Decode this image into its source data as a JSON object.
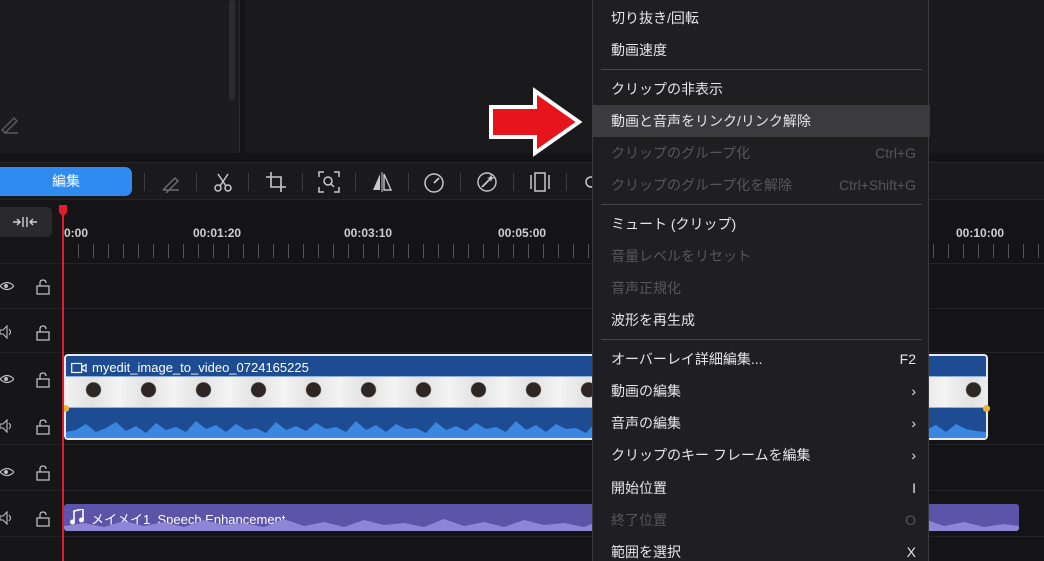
{
  "toolbar": {
    "edit_label": "編集",
    "icons": [
      "pen-icon",
      "scissors-icon",
      "crop-icon",
      "zoom-focus-icon",
      "mirror-icon",
      "speed-gauge-icon",
      "magic-wand-icon",
      "film-strip-icon",
      "settings-icon"
    ]
  },
  "ruler": {
    "ticks": [
      "0:00",
      "00:01:20",
      "00:03:10",
      "00:05:00",
      "00:10:00"
    ]
  },
  "clips": {
    "video_title": "myedit_image_to_video_0724165225",
    "audio_title": "メイメイ1_Speech Enhancement"
  },
  "colors": {
    "accent": "#2f8bf0",
    "video_clip": "#1d4c93",
    "audio_clip": "#5c54a8",
    "playhead": "#e11d2b",
    "annotation_arrow": "#e8141c"
  },
  "menu": {
    "items": [
      {
        "label": "切り抜き/回転",
        "shortcut": "",
        "state": "enabled"
      },
      {
        "label": "動画速度",
        "shortcut": "",
        "state": "enabled"
      },
      {
        "label": "クリップの非表示",
        "shortcut": "",
        "state": "enabled"
      },
      {
        "label": "動画と音声をリンク/リンク解除",
        "shortcut": "",
        "state": "highlighted"
      },
      {
        "label": "クリップのグループ化",
        "shortcut": "Ctrl+G",
        "state": "disabled"
      },
      {
        "label": "クリップのグループ化を解除",
        "shortcut": "Ctrl+Shift+G",
        "state": "disabled"
      },
      {
        "label": "ミュート (クリップ)",
        "shortcut": "",
        "state": "enabled"
      },
      {
        "label": "音量レベルをリセット",
        "shortcut": "",
        "state": "disabled"
      },
      {
        "label": "音声正規化",
        "shortcut": "",
        "state": "disabled"
      },
      {
        "label": "波形を再生成",
        "shortcut": "",
        "state": "enabled"
      },
      {
        "label": "オーバーレイ詳細編集...",
        "shortcut": "F2",
        "state": "enabled"
      },
      {
        "label": "動画の編集",
        "shortcut": "›",
        "state": "enabled"
      },
      {
        "label": "音声の編集",
        "shortcut": "›",
        "state": "enabled"
      },
      {
        "label": "クリップのキー フレームを編集",
        "shortcut": "›",
        "state": "enabled"
      },
      {
        "label": "開始位置",
        "shortcut": "I",
        "state": "enabled"
      },
      {
        "label": "終了位置",
        "shortcut": "O",
        "state": "disabled"
      },
      {
        "label": "範囲を選択",
        "shortcut": "X",
        "state": "enabled"
      }
    ]
  }
}
